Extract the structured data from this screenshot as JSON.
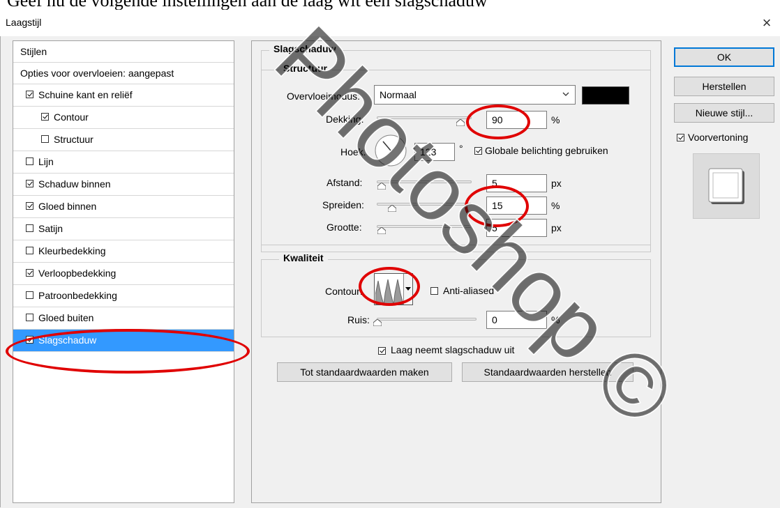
{
  "top_caption": "Geef nu de volgende instellingen aan de laag wit een slagschaduw",
  "window": {
    "title": "Laagstijl",
    "close_glyph": "×"
  },
  "styles_panel": {
    "header": "Stijlen",
    "blend_options": "Opties voor overvloeien: aangepast",
    "items": [
      {
        "label": "Schuine kant en reliëf",
        "checked": true,
        "indent": 0
      },
      {
        "label": "Contour",
        "checked": true,
        "indent": 1
      },
      {
        "label": "Structuur",
        "checked": false,
        "indent": 1
      },
      {
        "label": "Lijn",
        "checked": false,
        "indent": 0
      },
      {
        "label": "Schaduw binnen",
        "checked": true,
        "indent": 0
      },
      {
        "label": "Gloed binnen",
        "checked": true,
        "indent": 0
      },
      {
        "label": "Satijn",
        "checked": false,
        "indent": 0
      },
      {
        "label": "Kleurbedekking",
        "checked": false,
        "indent": 0
      },
      {
        "label": "Verloopbedekking",
        "checked": true,
        "indent": 0
      },
      {
        "label": "Patroonbedekking",
        "checked": false,
        "indent": 0
      },
      {
        "label": "Gloed buiten",
        "checked": false,
        "indent": 0
      },
      {
        "label": "Slagschaduw",
        "checked": true,
        "indent": 0,
        "selected": true
      }
    ]
  },
  "drop_shadow": {
    "section_title": "Slagschaduw",
    "structure_title": "Structuur",
    "blend_mode_label": "Overvloeimodus:",
    "blend_mode_value": "Normaal",
    "shadow_color": "#000000",
    "opacity_label": "Dekking:",
    "opacity_value": "90",
    "opacity_unit": "%",
    "angle_label": "Hoek:",
    "angle_value": "123",
    "angle_unit": "°",
    "global_light_label": "Globale belichting gebruiken",
    "global_light_checked": true,
    "distance_label": "Afstand:",
    "distance_value": "5",
    "distance_unit": "px",
    "spread_label": "Spreiden:",
    "spread_value": "15",
    "spread_unit": "%",
    "size_label": "Grootte:",
    "size_value": "5",
    "size_unit": "px",
    "quality_title": "Kwaliteit",
    "contour_label": "Contour:",
    "anti_alias_label": "Anti-aliased",
    "anti_alias_checked": false,
    "noise_label": "Ruis:",
    "noise_value": "0",
    "noise_unit": "%",
    "knocks_out_label": "Laag neemt slagschaduw uit",
    "knocks_out_checked": true,
    "make_default_button": "Tot standaardwaarden maken",
    "reset_default_button": "Standaardwaarden herstellen"
  },
  "right_panel": {
    "ok_button": "OK",
    "reset_button": "Herstellen",
    "new_style_button": "Nieuwe stijl...",
    "preview_label": "Voorvertoning",
    "preview_checked": true
  },
  "watermark": "Photoshop ©",
  "highlight_color": "#e00000"
}
